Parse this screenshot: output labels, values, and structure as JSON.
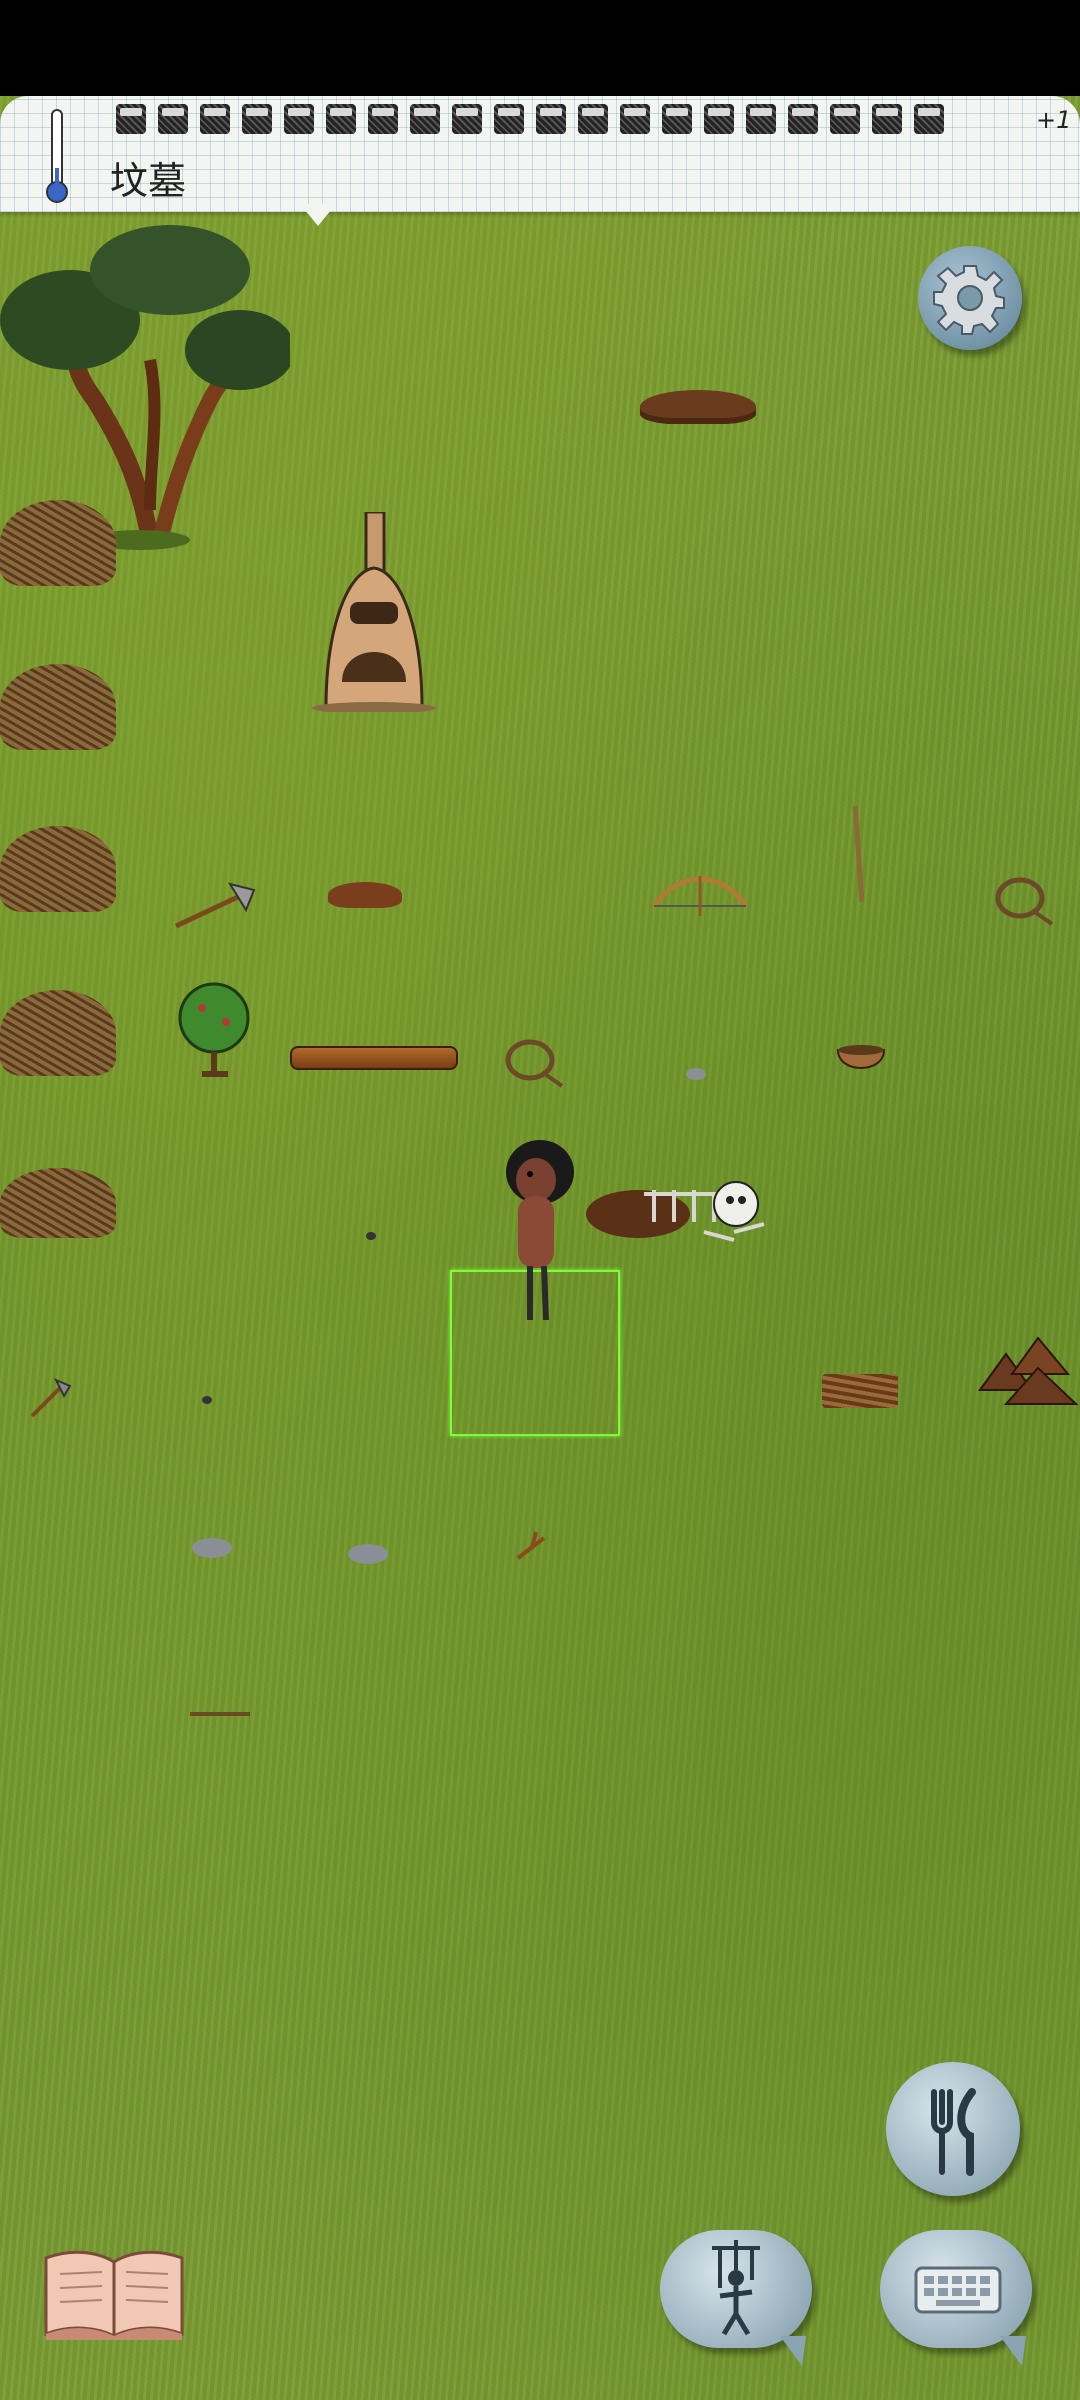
{
  "status_bar": {},
  "top_bar": {
    "location_name": "坟墓",
    "hunger_pips_count": 20,
    "bonus_label": "+1",
    "thermometer_icon": "thermometer-icon"
  },
  "buttons": {
    "settings": "gear-icon",
    "eat": "fork-knife-icon",
    "emote": "puppet-icon",
    "chat": "keyboard-icon",
    "tech_tree": "book-icon"
  },
  "colors": {
    "grass": "#74982f",
    "paper": "#f3f5f1",
    "button": "#8aa4b3",
    "selection": "#7cff3a"
  },
  "scene_objects": [
    "juniper-tree",
    "kindling-pile",
    "adobe-kiln",
    "dug-soil",
    "steel-axe",
    "bow",
    "long-shaft",
    "rope",
    "gooseberry-bush",
    "butt-log",
    "clay-bowl",
    "player-character",
    "skeleton-grave",
    "firewood-bundle",
    "clay-deposit",
    "stone-hatchet",
    "flint-chips",
    "branch",
    "stick"
  ]
}
